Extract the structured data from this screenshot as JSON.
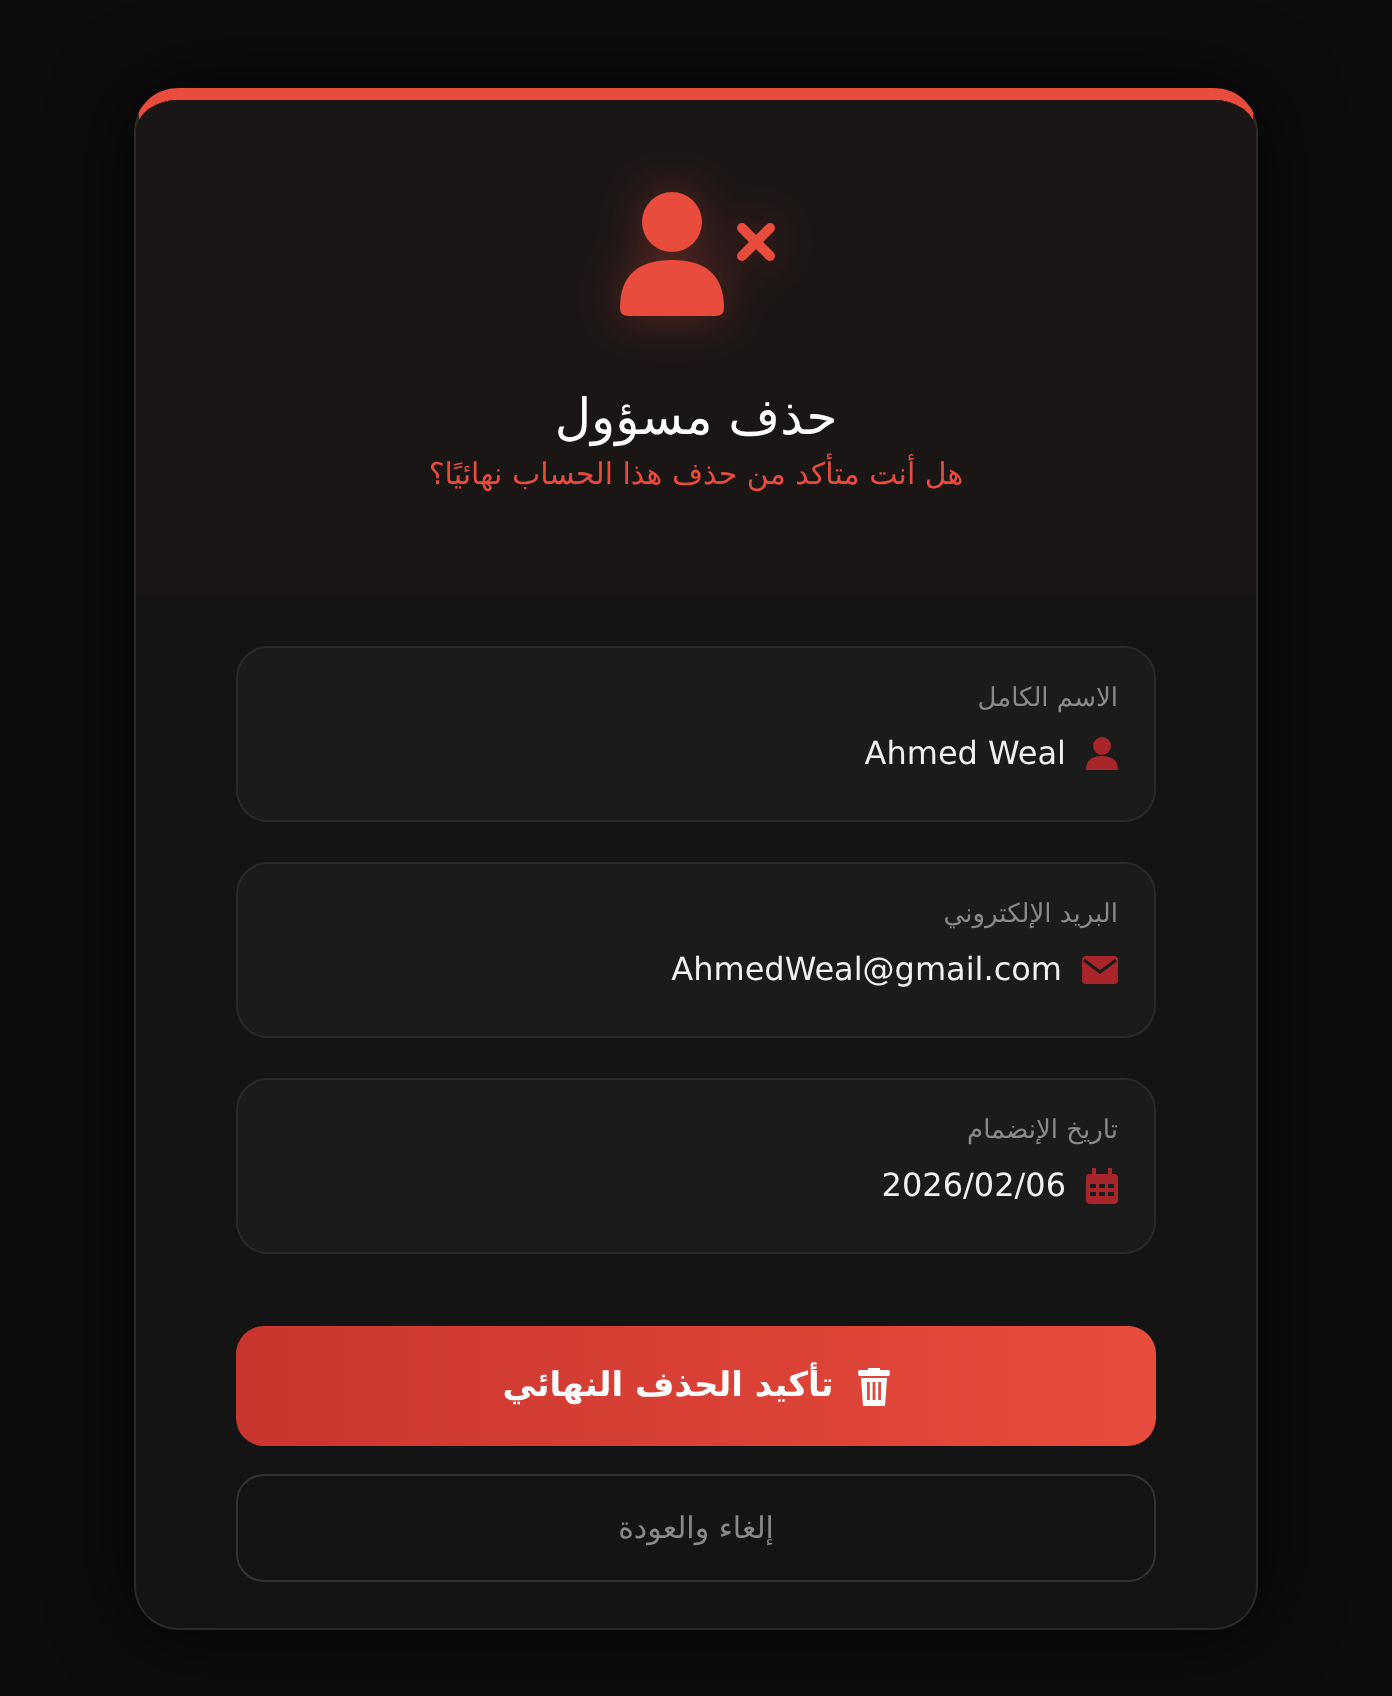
{
  "dialog": {
    "title": "حذف مسؤول",
    "subtitle": "هل أنت متأكد من حذف هذا الحساب نهائيًا؟"
  },
  "fields": [
    {
      "kind": "person",
      "label": "الاسم الكامل",
      "value": "Ahmed Weal"
    },
    {
      "kind": "email",
      "label": "البريد الإلكتروني",
      "value": "AhmedWeal@gmail.com"
    },
    {
      "kind": "date",
      "label": "تاريخ الإنضمام",
      "value": "2026/02/06"
    }
  ],
  "buttons": [
    {
      "kind": "danger",
      "label": "تأكيد الحذف النهائي"
    },
    {
      "kind": "cancel",
      "label": "إلغاء والعودة"
    }
  ]
}
